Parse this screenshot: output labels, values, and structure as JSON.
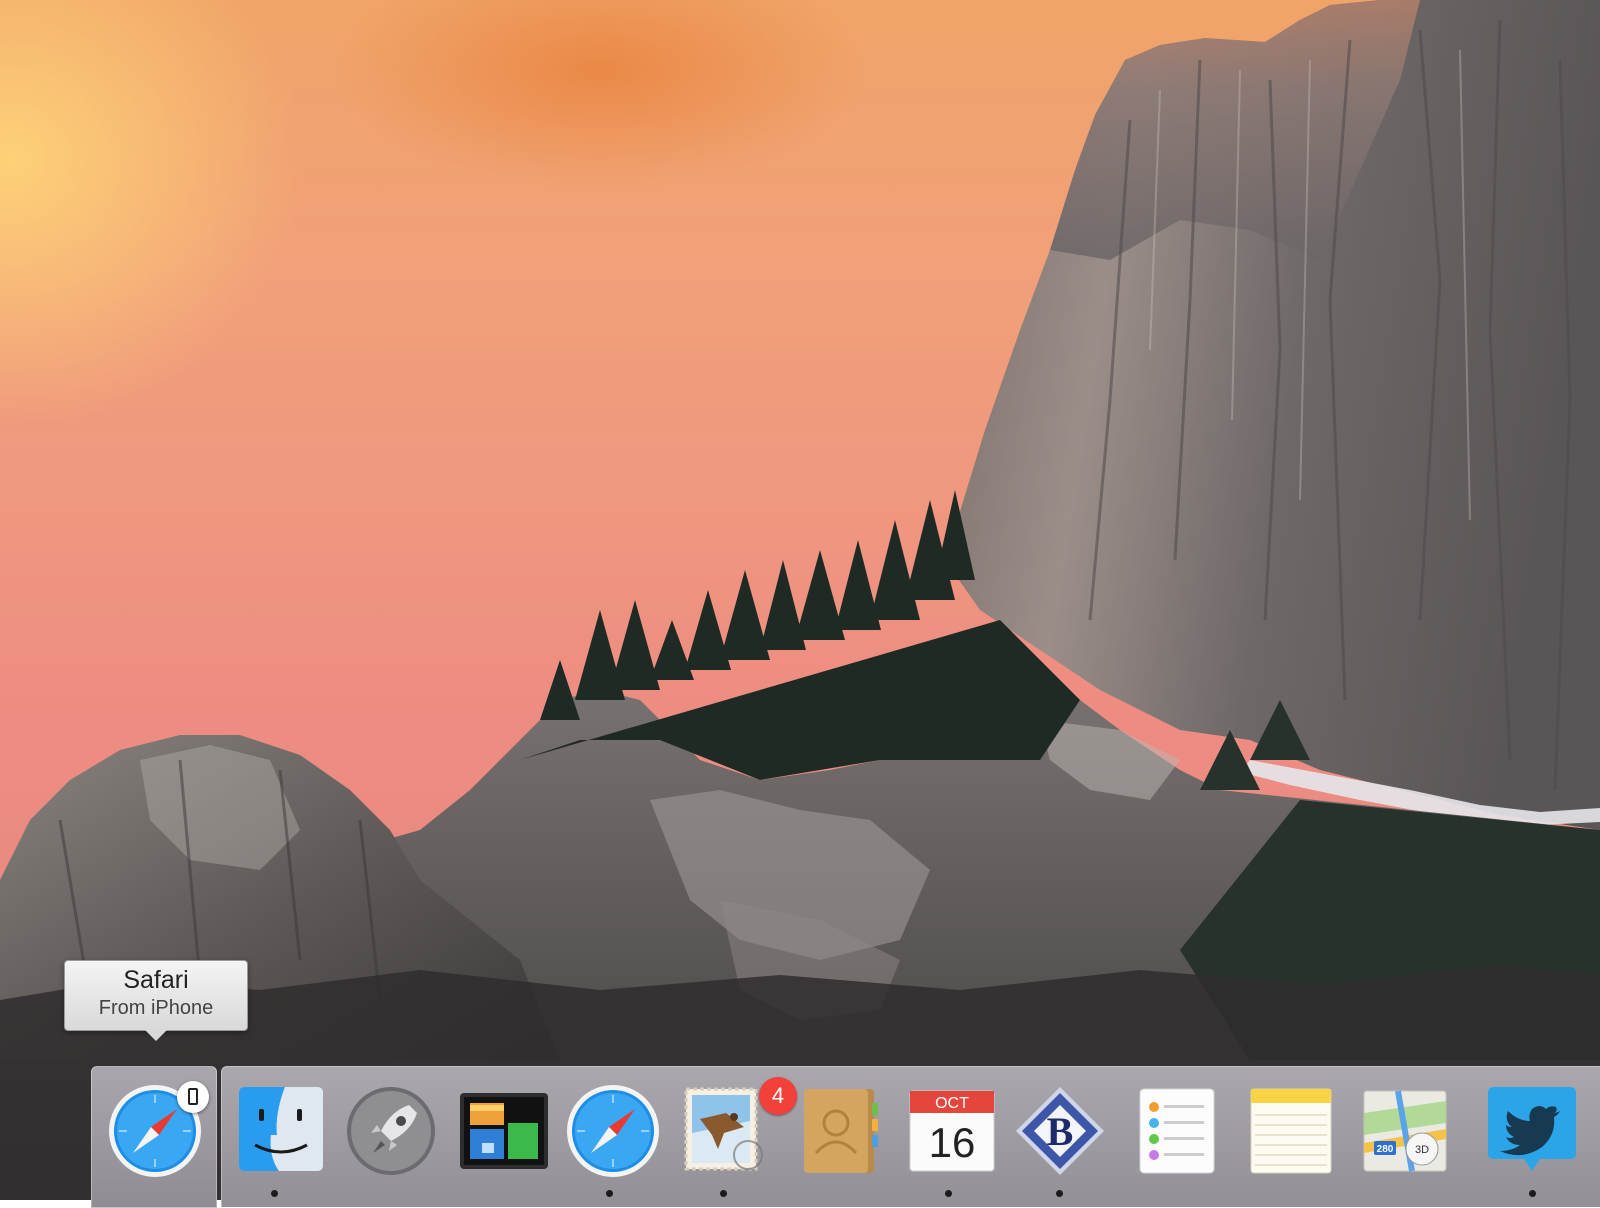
{
  "tooltip": {
    "title": "Safari",
    "subtitle": "From iPhone"
  },
  "handoff": {
    "app": "Safari",
    "icon": "safari-compass-icon",
    "device_icon": "iphone-icon"
  },
  "dock": {
    "apps": [
      {
        "name": "Finder",
        "icon": "finder-icon",
        "running": true
      },
      {
        "name": "Launchpad",
        "icon": "launchpad-rocket-icon",
        "running": false
      },
      {
        "name": "Mission Control",
        "icon": "mission-control-icon",
        "running": false
      },
      {
        "name": "Safari",
        "icon": "safari-compass-icon",
        "running": true
      },
      {
        "name": "Mail",
        "icon": "mail-stamp-icon",
        "running": true,
        "badge": "4"
      },
      {
        "name": "Contacts",
        "icon": "contacts-book-icon",
        "running": false
      },
      {
        "name": "Calendar",
        "icon": "calendar-icon",
        "running": true,
        "month": "OCT",
        "day": "16"
      },
      {
        "name": "BBEdit",
        "icon": "bbedit-b-icon",
        "running": true
      },
      {
        "name": "Reminders",
        "icon": "reminders-list-icon",
        "running": false
      },
      {
        "name": "Notes",
        "icon": "notes-pad-icon",
        "running": false
      },
      {
        "name": "Maps",
        "icon": "maps-icon",
        "running": false,
        "road_label": "280",
        "mode_label": "3D"
      },
      {
        "name": "Twitter",
        "icon": "twitter-bird-icon",
        "running": true
      }
    ]
  },
  "colors": {
    "badge": "#f2403a",
    "dock": "#9d9aa1",
    "sky_top": "#f0a468",
    "sky_bottom": "#e88a80"
  }
}
